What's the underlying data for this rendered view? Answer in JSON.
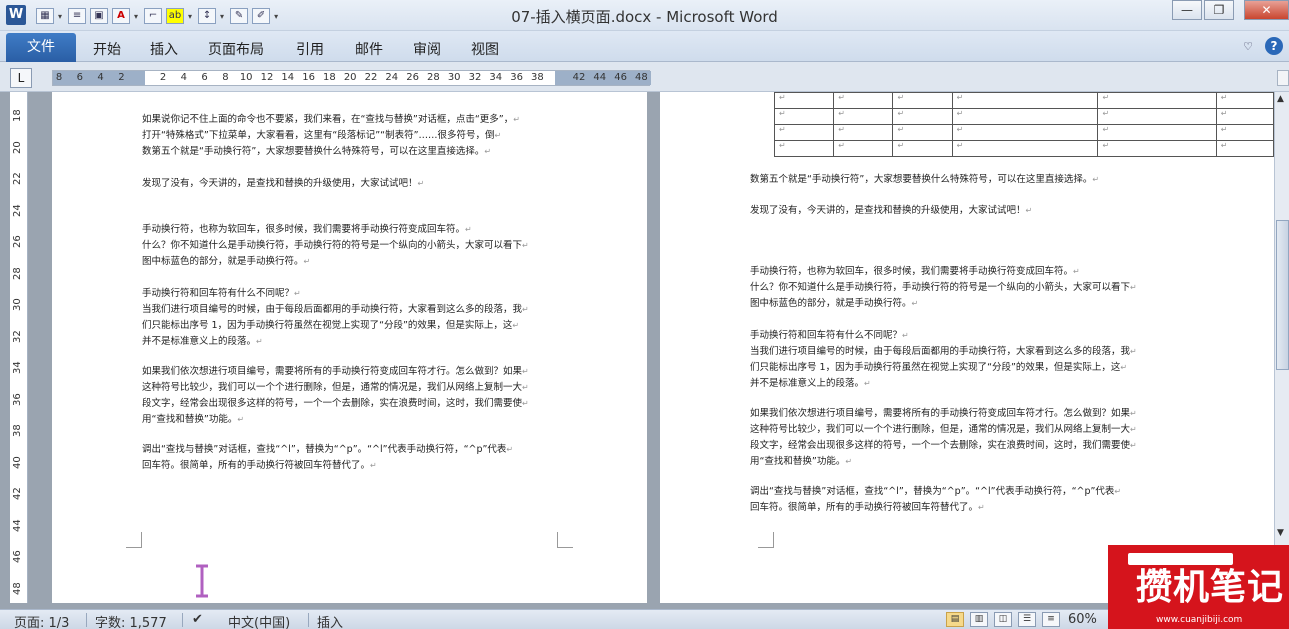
{
  "window": {
    "title": "07-插入横页面.docx - Microsoft Word",
    "app_icon_letter": "W",
    "controls": {
      "minimize": "—",
      "restore": "❐",
      "close": "✕"
    }
  },
  "ribbon": {
    "file_tab": "文件",
    "tabs": [
      "开始",
      "插入",
      "页面布局",
      "引用",
      "邮件",
      "审阅",
      "视图"
    ]
  },
  "ruler": {
    "ticks": [
      "8",
      "6",
      "4",
      "2",
      "",
      "2",
      "4",
      "6",
      "8",
      "10",
      "12",
      "14",
      "16",
      "18",
      "20",
      "22",
      "24",
      "26",
      "28",
      "30",
      "32",
      "34",
      "36",
      "38",
      "",
      "42",
      "44",
      "46",
      "48"
    ],
    "vticks": [
      "18",
      "20",
      "22",
      "24",
      "26",
      "28",
      "30",
      "32",
      "34",
      "36",
      "38",
      "40",
      "42",
      "44",
      "46",
      "48"
    ]
  },
  "doc": {
    "left_page": [
      "如果说你记不住上面的命令也不要紧，我们来看，在“查找与替换”对话框，点击“更多”，",
      "打开“特殊格式”下拉菜单，大家看看，这里有“段落标记”“制表符”……很多符号，倒",
      "数第五个就是“手动换行符”，大家想要替换什么特殊符号，可以在这里直接选择。",
      "发现了没有，今天讲的，是查找和替换的升级使用，大家试试吧！",
      "手动换行符，也称为软回车，很多时候，我们需要将手动换行符变成回车符。",
      "什么？你不知道什么是手动换行符，手动换行符的符号是一个纵向的小箭头，大家可以看下",
      "图中标蓝色的部分，就是手动换行符。",
      "手动换行符和回车符有什么不同呢？",
      "当我们进行项目编号的时候，由于每段后面都用的手动换行符，大家看到这么多的段落，我",
      "们只能标出序号 1，因为手动换行符虽然在视觉上实现了“分段”的效果，但是实际上，这",
      "并不是标准意义上的段落。",
      "如果我们依次想进行项目编号，需要将所有的手动换行符变成回车符才行。怎么做到？如果",
      "这种符号比较少，我们可以一个个进行删除，但是，通常的情况是，我们从网络上复制一大",
      "段文字，经常会出现很多这样的符号，一个一个去删除，实在浪费时间，这时，我们需要使",
      "用“查找和替换”功能。",
      "调出“查找与替换”对话框，查找“^l”，替换为“^p”。“^l”代表手动换行符，“^p”代表",
      "回车符。很简单，所有的手动换行符被回车符替代了。"
    ],
    "right_page": [
      "数第五个就是“手动换行符”，大家想要替换什么特殊符号，可以在这里直接选择。",
      "发现了没有，今天讲的，是查找和替换的升级使用，大家试试吧！",
      "手动换行符，也称为软回车，很多时候，我们需要将手动换行符变成回车符。",
      "什么？你不知道什么是手动换行符，手动换行符的符号是一个纵向的小箭头，大家可以看下",
      "图中标蓝色的部分，就是手动换行符。",
      "手动换行符和回车符有什么不同呢？",
      "当我们进行项目编号的时候，由于每段后面都用的手动换行符，大家看到这么多的段落，我",
      "们只能标出序号 1，因为手动换行符虽然在视觉上实现了“分段”的效果，但是实际上，这",
      "并不是标准意义上的段落。",
      "如果我们依次想进行项目编号，需要将所有的手动换行符变成回车符才行。怎么做到？如果",
      "这种符号比较少，我们可以一个个进行删除，但是，通常的情况是，我们从网络上复制一大",
      "段文字，经常会出现很多这样的符号，一个一个去删除，实在浪费时间，这时，我们需要使",
      "用“查找和替换”功能。",
      "调出“查找与替换”对话框，查找“^l”，替换为“^p”。“^l”代表手动换行符，“^p”代表",
      "回车符。很简单，所有的手动换行符被回车符替代了。"
    ],
    "para_mark": "↵"
  },
  "status": {
    "page": "页面: 1/3",
    "words": "字数: 1,577",
    "language": "中文(中国)",
    "mode": "插入",
    "zoom": "60%"
  },
  "watermark": {
    "text": "攒机笔记",
    "url": "www.cuanjibiji.com"
  },
  "colors": {
    "file_tab": "#2a5ea5",
    "watermark_red": "#d5141c"
  }
}
